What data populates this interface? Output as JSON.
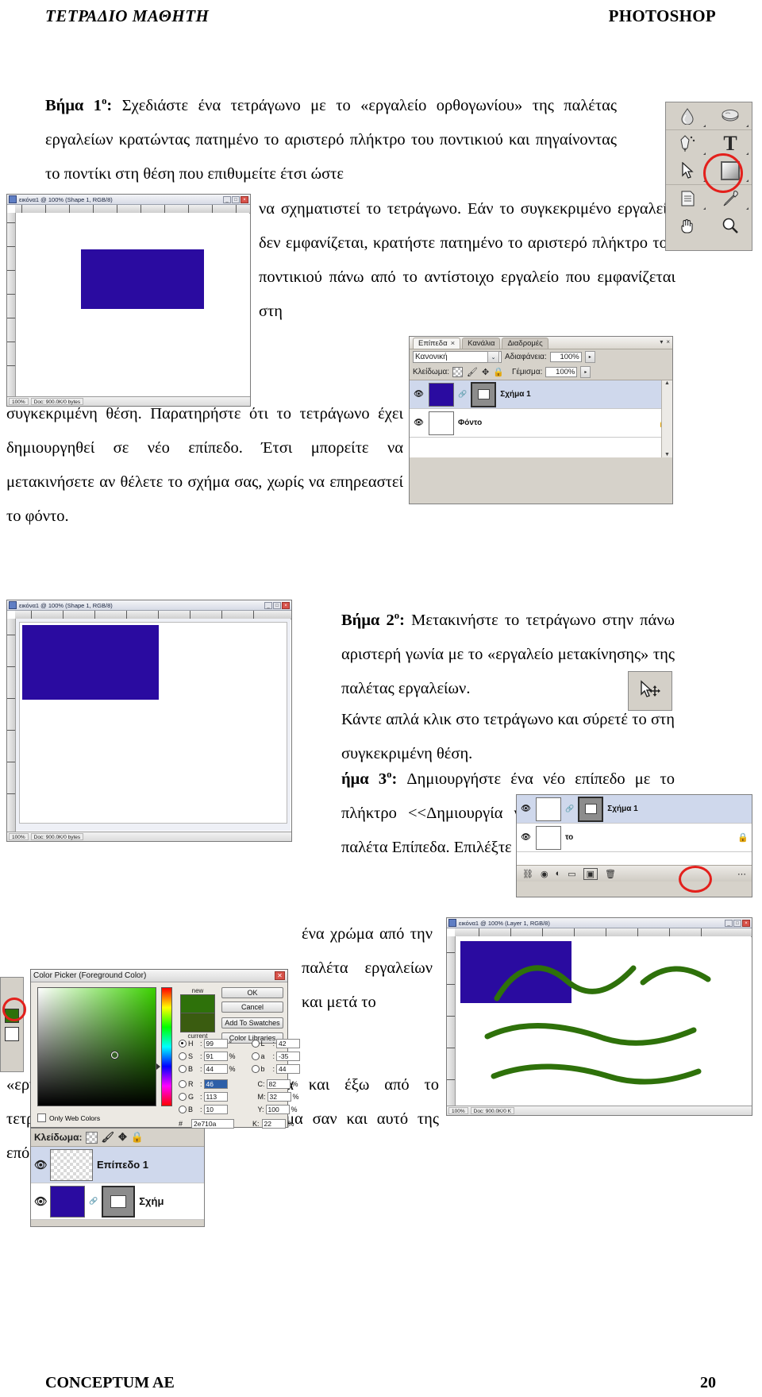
{
  "header": {
    "left": "ΤΕΤΡΑΔΙΟ ΜΑΘΗΤΗ",
    "right": "PHOTOSHOP"
  },
  "footer": {
    "left": "CONCEPTUM AE",
    "page": "20"
  },
  "body": {
    "step1_label": "Βήμα 1",
    "step1_sup": "ο",
    "step1_colon": ": ",
    "step1_p1": "Σχεδιάστε ένα τετράγωνο με το «εργαλείο ορθογωνίου» της παλέτας εργαλείων κρατώντας πατημένο το αριστερό πλήκτρο του ποντικιού και πηγαίνοντας το ποντίκι στη θέση που επιθυμείτε έτσι ώστε",
    "step1_p2": "να σχηματιστεί το τετράγωνο. Εάν το συγκεκριμένο εργαλείο δεν εμφανίζεται, κρατήστε πατημένο το αριστερό πλήκτρο του ποντικιού πάνω από το αντίστοιχο εργαλείο που εμφανίζεται στη",
    "step1_p3": "συγκεκριμένη θέση. Παρατηρήστε ότι το τετράγωνο έχει δημιουργηθεί σε νέο επίπεδο. Έτσι μπορείτε να μετακινήσετε αν θέλετε το σχήμα σας, χωρίς να επηρεαστεί το φόντο.",
    "step2_label": "Βήμα 2",
    "step2_sup": "ο",
    "step2_p1": "Μετακινήστε το τετράγωνο στην πάνω αριστερή γωνία με το «εργαλείο μετακίνησης» της παλέτας εργαλείων.",
    "step2_p2": "Κάντε απλά κλικ στο τετράγωνο και σύρετέ το στη συγκεκριμένη θέση.",
    "step3_label": "ήμα 3",
    "step3_sup": "ο",
    "step3_p1": "Δημιουργήστε ένα νέο επίπεδο με το πλήκτρο <<Δημιουργία νέου επιπέδου>> στην παλέτα Επίπεδα.  Επιλέξτε",
    "step3_p2": "ένα χρώμα από την παλέτα εργαλείων και μετά το",
    "step3_p3": "«εργαλείο πινέλου». Ζωγραφίστε μέσα και έξω από το τετράγωνο. Θα καταλήξετε με ένα σχήμα σαν και αυτό της επόμενης εικόνας."
  },
  "window1": {
    "title": "εικόνα1 @ 100% (Shape 1, RGB/8)",
    "zoom": "100%",
    "doc": "Doc: 900.0K/0 bytes",
    "minimize": "_",
    "maximize": "□",
    "close": "×"
  },
  "window2": {
    "title": "εικόνα1 @ 100% (Shape 1, RGB/8)",
    "zoom": "100%",
    "doc": "Doc: 900.0K/0 bytes",
    "minimize": "_",
    "maximize": "□",
    "close": "×"
  },
  "window3": {
    "title": "εικόνα1 @ 100% (Layer 1, RGB/8)",
    "zoom": "100%",
    "doc": "Doc: 900.0K/0 K",
    "minimize": "_",
    "maximize": "□",
    "close": "×"
  },
  "tools": {
    "icons": [
      {
        "name": "blur-tool-icon",
        "glyph": "💧"
      },
      {
        "name": "dodge-tool-icon",
        "glyph": "◓"
      },
      {
        "name": "pen-tool-icon",
        "glyph": "✒"
      },
      {
        "name": "type-tool-icon",
        "glyph": "T"
      },
      {
        "name": "path-selection-tool-icon",
        "glyph": "➤"
      },
      {
        "name": "rectangle-tool-icon",
        "glyph": ""
      },
      {
        "name": "notes-tool-icon",
        "glyph": "🗒"
      },
      {
        "name": "eyedropper-tool-icon",
        "glyph": "💉"
      },
      {
        "name": "hand-tool-icon",
        "glyph": "✋"
      },
      {
        "name": "zoom-tool-icon",
        "glyph": "🔍"
      }
    ],
    "move_tool_glyph": "✥",
    "brush_tool_glyph": "🖌"
  },
  "layers_palette": {
    "tabs": [
      {
        "label": "Επίπεδα",
        "close": "×",
        "active": true
      },
      {
        "label": "Κανάλια",
        "active": false
      },
      {
        "label": "Διαδρομές",
        "active": false
      }
    ],
    "win_minimize": "▾",
    "win_close": "×",
    "blend_mode": "Κανονική",
    "blend_arrow": "⌄",
    "opacity_label": "Αδιαφάνεια:",
    "opacity_value": "100%",
    "opacity_arrow": "▸",
    "lock_label": "Κλείδωμα:",
    "lock_icons": [
      "▨",
      "🖌",
      "✥",
      "🔒"
    ],
    "fill_label": "Γέμισμα:",
    "fill_value": "100%",
    "fill_arrow": "▸",
    "layers": [
      {
        "name": "Σχήμα 1",
        "eye": "👁",
        "type": "shape",
        "locked": false,
        "selected": true
      },
      {
        "name": "Φόντο",
        "eye": "👁",
        "type": "background",
        "locked": true,
        "lock_glyph": "🔒",
        "selected": false
      }
    ],
    "scroll_up": "▲",
    "scroll_down": "▼"
  },
  "layers_palette2": {
    "layer_name": "Σχήμα 1",
    "layer_name2": "το",
    "lock_glyph": "🔒",
    "bottom_icons": [
      "◉",
      "◐",
      "▭",
      "▣",
      "🗑"
    ]
  },
  "layers_palette3": {
    "lock_label": "Κλείδωμα:",
    "lock_icons": [
      "▨",
      "🖌",
      "✥",
      "🔒"
    ],
    "layers": [
      {
        "name": "Επίπεδο 1",
        "eye": "👁"
      },
      {
        "name": "Σχήμ",
        "eye": "👁"
      }
    ]
  },
  "color_picker": {
    "title": "Color Picker (Foreground Color)",
    "close": "✕",
    "new_label": "new",
    "current_label": "current",
    "buttons": [
      "OK",
      "Cancel",
      "Add To Swatches",
      "Color Libraries"
    ],
    "hsb": [
      {
        "key": "H",
        "value": "99",
        "unit": "°",
        "selected": true
      },
      {
        "key": "S",
        "value": "91",
        "unit": "%",
        "selected": false
      },
      {
        "key": "B",
        "value": "44",
        "unit": "%",
        "selected": false
      }
    ],
    "lab": [
      {
        "key": "L",
        "value": "42",
        "unit": ""
      },
      {
        "key": "a",
        "value": "-35",
        "unit": ""
      },
      {
        "key": "b",
        "value": "44",
        "unit": ""
      }
    ],
    "rgb": [
      {
        "key": "R",
        "value": "46",
        "unit": "",
        "selected": false,
        "highlight": true
      },
      {
        "key": "G",
        "value": "113",
        "unit": "",
        "selected": false
      },
      {
        "key": "B",
        "value": "10",
        "unit": "",
        "selected": false
      }
    ],
    "cmyk": [
      {
        "key": "C",
        "value": "82",
        "unit": "%"
      },
      {
        "key": "M",
        "value": "32",
        "unit": "%"
      },
      {
        "key": "Y",
        "value": "100",
        "unit": "%"
      },
      {
        "key": "K",
        "value": "22",
        "unit": "%"
      }
    ],
    "hex_label": "#",
    "hex_value": "2e710a",
    "only_web_label": "Only Web Colors",
    "new_color": "#2e710a",
    "current_color": "#2e710a"
  },
  "colors": {
    "shape_blue": "#2a0ba0",
    "brush_green": "#2e710a",
    "highlight_red": "#e3201c"
  }
}
